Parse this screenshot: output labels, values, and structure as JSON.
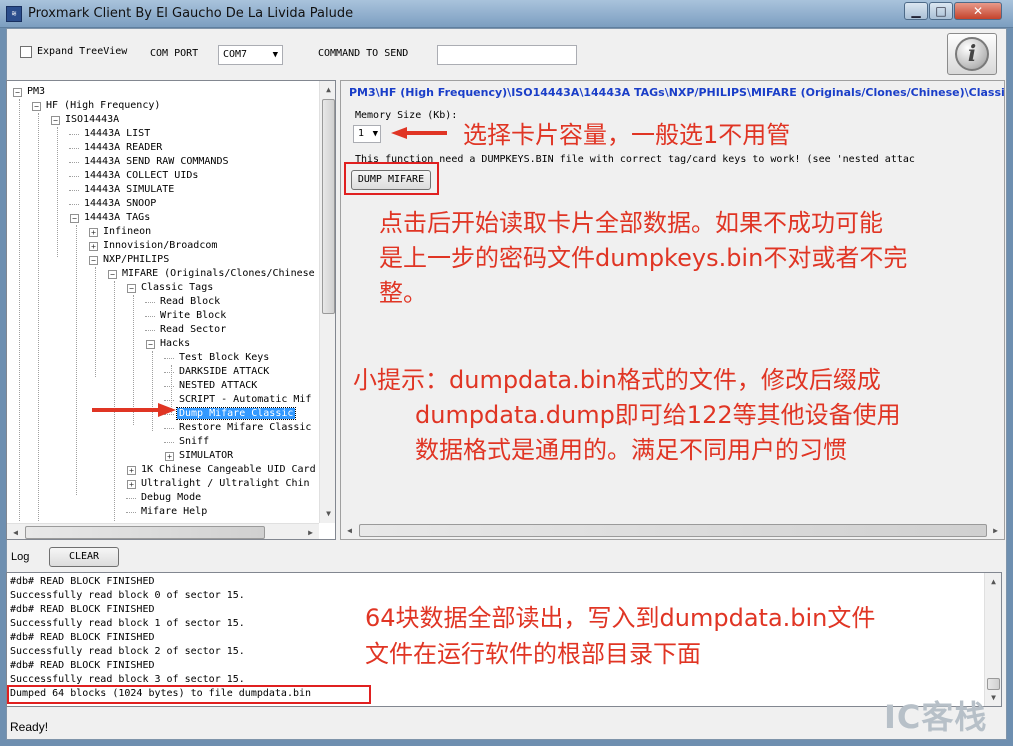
{
  "window": {
    "title": "Proxmark Client By El Gaucho De La Livida Palude",
    "minimize_glyph": "▁",
    "maximize_glyph": "□",
    "close_glyph": "✕"
  },
  "toolbar": {
    "expand_treeview_label": "Expand TreeView",
    "com_port_label": "COM PORT",
    "com_port_value": "COM7",
    "command_label": "COMMAND TO SEND",
    "command_value": "",
    "info_glyph": "i"
  },
  "tree": {
    "items": [
      {
        "label": "PM3"
      },
      {
        "label": "HF (High Frequency)"
      },
      {
        "label": "ISO14443A"
      },
      {
        "label": "14443A LIST"
      },
      {
        "label": "14443A READER"
      },
      {
        "label": "14443A SEND RAW COMMANDS"
      },
      {
        "label": "14443A COLLECT UIDs"
      },
      {
        "label": "14443A SIMULATE"
      },
      {
        "label": "14443A SNOOP"
      },
      {
        "label": "14443A TAGs"
      },
      {
        "label": "Infineon"
      },
      {
        "label": "Innovision/Broadcom"
      },
      {
        "label": "NXP/PHILIPS"
      },
      {
        "label": "MIFARE (Originals/Clones/Chinese"
      },
      {
        "label": "Classic Tags"
      },
      {
        "label": "Read Block"
      },
      {
        "label": "Write Block"
      },
      {
        "label": "Read Sector"
      },
      {
        "label": "Hacks"
      },
      {
        "label": "Test Block Keys"
      },
      {
        "label": "DARKSIDE ATTACK"
      },
      {
        "label": "NESTED ATTACK"
      },
      {
        "label": "SCRIPT - Automatic Mif"
      },
      {
        "label": "Dump Mifare Classic"
      },
      {
        "label": "Restore Mifare Classic"
      },
      {
        "label": "Sniff"
      },
      {
        "label": "SIMULATOR"
      },
      {
        "label": "1K Chinese Cangeable UID Card"
      },
      {
        "label": "Ultralight / Ultralight Chin"
      },
      {
        "label": "Debug Mode"
      },
      {
        "label": "Mifare Help"
      }
    ]
  },
  "panel": {
    "breadcrumb": "PM3\\HF (High Frequency)\\ISO14443A\\14443A TAGs\\NXP/PHILIPS\\MIFARE (Originals/Clones/Chinese)\\Classic T",
    "memory_size_label": "Memory Size (Kb):",
    "memory_size_value": "1",
    "note": "This function need a DUMPKEYS.BIN file with correct tag/card keys to work! (see 'nested attac",
    "dump_button": "DUMP MIFARE",
    "annotation_1": "选择卡片容量，一般选1不用管",
    "annotation_2": [
      "点击后开始读取卡片全部数据。如果不成功可能",
      "是上一步的密码文件dumpkeys.bin不对或者不完",
      "整。"
    ],
    "annotation_3": [
      "小提示：dumpdata.bin格式的文件，修改后缀成",
      "dumpdata.dump即可给122等其他设备使用",
      "数据格式是通用的。满足不同用户的习惯"
    ]
  },
  "log": {
    "label": "Log",
    "clear_button": "CLEAR",
    "lines": [
      "#db# READ BLOCK FINISHED",
      "Successfully read block  0 of sector 15.",
      "#db# READ BLOCK FINISHED",
      "Successfully read block  1 of sector 15.",
      "#db# READ BLOCK FINISHED",
      "Successfully read block  2 of sector 15.",
      "#db# READ BLOCK FINISHED",
      "Successfully read block  3 of sector 15.",
      "Dumped 64 blocks (1024 bytes) to file dumpdata.bin"
    ],
    "annotation": [
      "64块数据全部读出，写入到dumpdata.bin文件",
      "文件在运行软件的根部目录下面"
    ]
  },
  "status": {
    "text": "Ready!"
  },
  "watermark": "IC客栈",
  "colors": {
    "annotation": "#e03524",
    "breadcrumb": "#1a3ec8",
    "selection": "#3399ff"
  }
}
